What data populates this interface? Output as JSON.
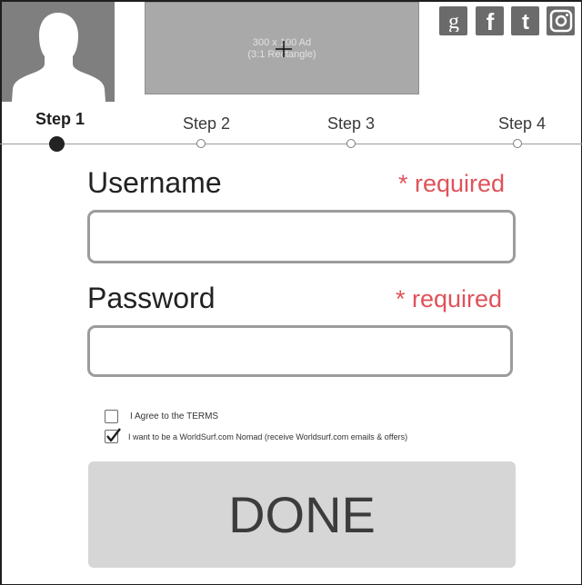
{
  "header": {
    "ad": {
      "line1": "300 x 100 Ad",
      "line2": "(3:1 Rectangle)"
    },
    "social": [
      {
        "icon": "google-plus-icon"
      },
      {
        "icon": "facebook-icon"
      },
      {
        "icon": "twitter-icon"
      },
      {
        "icon": "instagram-icon"
      }
    ]
  },
  "steps": {
    "items": [
      "Step 1",
      "Step 2",
      "Step 3",
      "Step 4"
    ],
    "active_index": 0
  },
  "form": {
    "username": {
      "label": "Username",
      "required": "* required",
      "value": ""
    },
    "password": {
      "label": "Password",
      "required": "* required",
      "value": ""
    },
    "agree": {
      "label": "I Agree to the TERMS",
      "checked": false
    },
    "nomad": {
      "label": "I want to be a WorldSurf.com Nomad (receive Worldsurf.com emails & offers)",
      "checked": true
    },
    "done_label": "DONE"
  },
  "colors": {
    "required": "#e0525a",
    "icon": "#6b6b6b",
    "ad_bg": "#a9a9a9",
    "button_bg": "#d6d6d6"
  }
}
